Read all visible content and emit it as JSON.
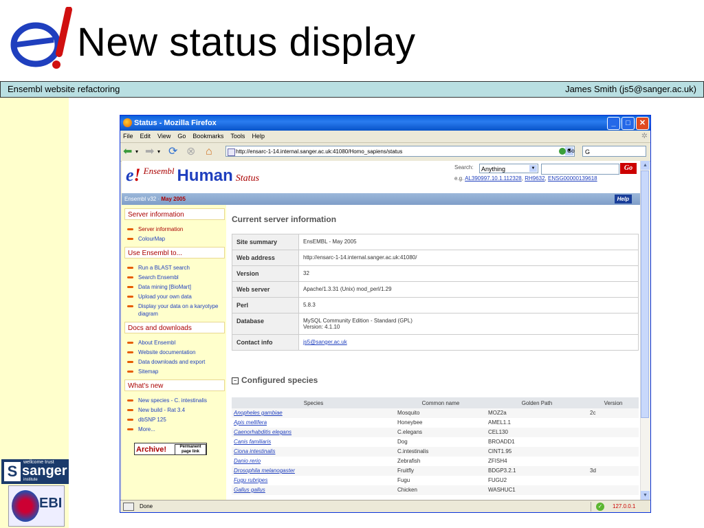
{
  "slide": {
    "title": "New status display",
    "subtitle_left": "Ensembl website refactoring",
    "subtitle_right": "James Smith (js5@sanger.ac.uk)",
    "sanger_logo": "sanger",
    "sanger_small": "wellcome trust",
    "sanger_institute": "institute",
    "ebi_logo": "EBI"
  },
  "window": {
    "title": "Status - Mozilla Firefox",
    "menus": [
      "File",
      "Edit",
      "View",
      "Go",
      "Bookmarks",
      "Tools",
      "Help"
    ],
    "url": "http://ensarc-1-14.internal.sanger.ac.uk:41080/Homo_sapiens/status",
    "go_label": "Go",
    "google_label": "G",
    "status_text": "Done",
    "status_ip": "127.0.0.1"
  },
  "page": {
    "logo_e": "e",
    "logo_bang": "!",
    "logo_ensembl": "Ensembl",
    "logo_human": "Human",
    "logo_status": "Status",
    "search_label": "Search:",
    "search_select": "Anything",
    "search_go": "Go",
    "search_eg_prefix": "e.g.",
    "search_examples": [
      "AL390997.10.1.112328",
      "RH9632",
      "ENSG00000139618"
    ],
    "version": "Ensembl v32",
    "version_date": "May 2005",
    "help_label": "Help",
    "sidebar": [
      {
        "heading": "Server information",
        "items": [
          "Server information",
          "ColourMap"
        ]
      },
      {
        "heading": "Use Ensembl to...",
        "items": [
          "Run a BLAST search",
          "Search Ensembl",
          "Data mining [BioMart]",
          "Upload your own data",
          "Display your data on a karyotype diagram"
        ]
      },
      {
        "heading": "Docs and downloads",
        "items": [
          "About Ensembl",
          "Website documentation",
          "Data downloads and export",
          "Sitemap"
        ]
      },
      {
        "heading": "What's new",
        "items": [
          "New species - C. intestinalis",
          "New build - Rat 3.4",
          "dbSNP 125",
          "More..."
        ]
      }
    ],
    "archive_label": "Archive",
    "archive_bang": "!",
    "archive_permalink": "Permanent page link",
    "current_heading": "Current server information",
    "server_info": [
      {
        "key": "Site summary",
        "value": "EnsEMBL - May 2005"
      },
      {
        "key": "Web address",
        "value": "http://ensarc-1-14.internal.sanger.ac.uk:41080/"
      },
      {
        "key": "Version",
        "value": "32"
      },
      {
        "key": "Web server",
        "value": "Apache/1.3.31 (Unix) mod_perl/1.29"
      },
      {
        "key": "Perl",
        "value": "5.8.3"
      },
      {
        "key": "Database",
        "value": "MySQL Community Edition - Standard (GPL)",
        "value2": "Version: 4.1.10"
      },
      {
        "key": "Contact info",
        "value": "js5@sanger.ac.uk"
      }
    ],
    "configured_heading": "Configured species",
    "species_columns": [
      "Species",
      "Common name",
      "Golden Path",
      "Version"
    ],
    "species_rows": [
      [
        "Anopheles gambiae",
        "Mosquito",
        "MOZ2a",
        "2c"
      ],
      [
        "Apis mellifera",
        "Honeybee",
        "AMEL1.1",
        ""
      ],
      [
        "Caenorhabditis elegans",
        "C.elegans",
        "CEL130",
        ""
      ],
      [
        "Canis familiaris",
        "Dog",
        "BROADD1",
        ""
      ],
      [
        "Ciona intestinalis",
        "C.intestinalis",
        "CINT1.95",
        ""
      ],
      [
        "Danio rerio",
        "Zebrafish",
        "ZFISH4",
        ""
      ],
      [
        "Drosophila melanogaster",
        "Fruitfly",
        "BDGP3.2.1",
        "3d"
      ],
      [
        "Fugu rubripes",
        "Fugu",
        "FUGU2",
        ""
      ],
      [
        "Gallus gallus",
        "Chicken",
        "WASHUC1",
        ""
      ]
    ]
  }
}
